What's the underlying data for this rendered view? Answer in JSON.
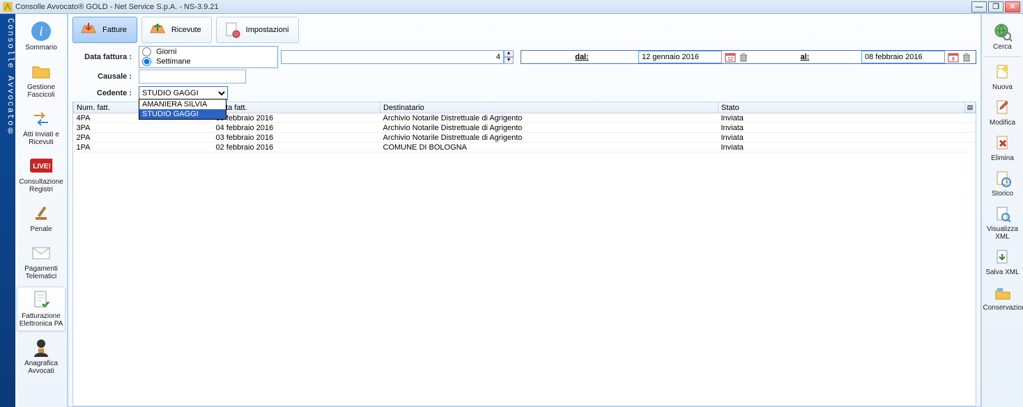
{
  "window": {
    "title": "Consolle Avvocato® GOLD - Net Service S.p.A. - NS-3.9.21"
  },
  "vstrip": "Consolle Avvocato®",
  "leftnav": [
    {
      "label": "Sommario"
    },
    {
      "label": "Gestione Fascicoli"
    },
    {
      "label": "Atti Inviati e Ricevuti"
    },
    {
      "label": "Consultazione Registri"
    },
    {
      "label": "Penale"
    },
    {
      "label": "Pagamenti Telematici"
    },
    {
      "label": "Fatturazione Elettronica PA",
      "selected": true
    },
    {
      "label": "Anagrafica Avvocati"
    }
  ],
  "toptabs": {
    "fatture": "Fatture",
    "ricevute": "Ricevute",
    "impostazioni": "Impostazioni"
  },
  "filters": {
    "data_fattura_label": "Data fattura :",
    "radio_giorni": "Giorni",
    "radio_settimane": "Settimane",
    "num_value": "4",
    "dal_label": "dal:",
    "dal_value": "12 gennaio 2016",
    "al_label": "al:",
    "al_value": "08 febbraio 2016",
    "causale_label": "Causale :",
    "causale_value": "",
    "cedente_label": "Cedente :",
    "cedente_value": "STUDIO GAGGI",
    "cedente_options": [
      "AMANIERA SILVIA",
      "STUDIO GAGGI"
    ]
  },
  "table": {
    "headers": {
      "num": "Num. fatt.",
      "data": "Data fatt.",
      "dest": "Destinatario",
      "stato": "Stato"
    },
    "rows": [
      {
        "num": "4PA",
        "data": "05 febbraio 2016",
        "dest": "Archivio Notarile Distrettuale di Agrigento",
        "stato": "Inviata"
      },
      {
        "num": "3PA",
        "data": "04 febbraio 2016",
        "dest": "Archivio Notarile Distrettuale di Agrigento",
        "stato": "Inviata"
      },
      {
        "num": "2PA",
        "data": "03 febbraio 2016",
        "dest": "Archivio Notarile Distrettuale di Agrigento",
        "stato": "Inviata"
      },
      {
        "num": "1PA",
        "data": "02 febbraio 2016",
        "dest": "COMUNE DI BOLOGNA",
        "stato": "Inviata"
      }
    ]
  },
  "rightbar": {
    "cerca": "Cerca",
    "nuova": "Nuova",
    "modifica": "Modifica",
    "elimina": "Elimina",
    "storico": "Storico",
    "visualizza_xml": "Visualizza XML",
    "salva_xml": "Salva XML",
    "conservazione": "Conservazione"
  }
}
